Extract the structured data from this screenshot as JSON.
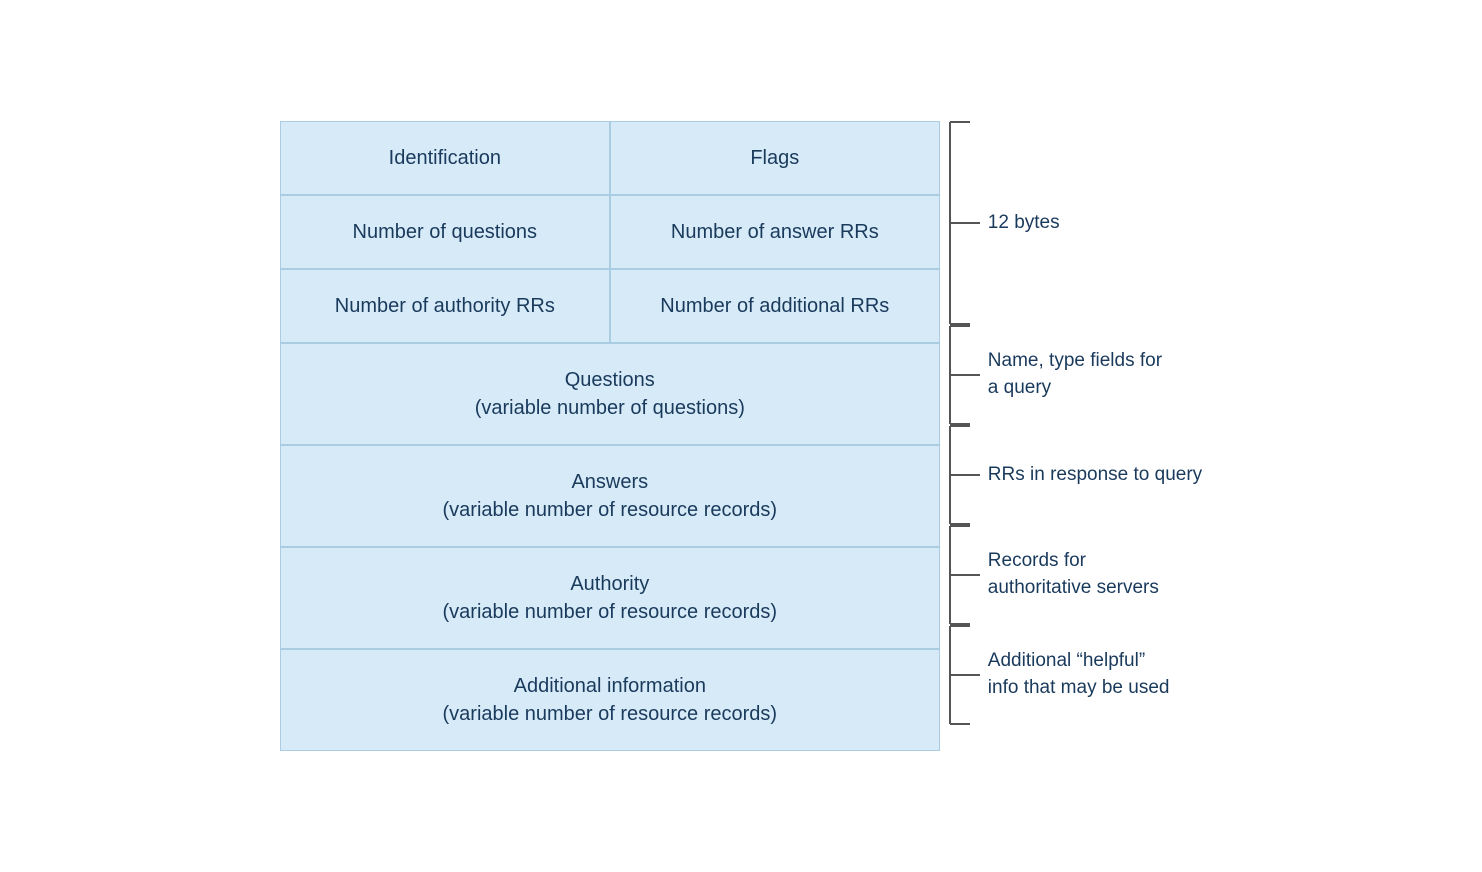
{
  "rows": [
    {
      "id": "row-identification",
      "cells": [
        {
          "id": "cell-identification",
          "text": "Identification",
          "span": "half"
        },
        {
          "id": "cell-flags",
          "text": "Flags",
          "span": "half"
        }
      ]
    },
    {
      "id": "row-questions-count",
      "cells": [
        {
          "id": "cell-num-questions",
          "text": "Number of questions",
          "span": "half"
        },
        {
          "id": "cell-num-answer-rrs",
          "text": "Number of answer RRs",
          "span": "half"
        }
      ]
    },
    {
      "id": "row-authority-count",
      "cells": [
        {
          "id": "cell-num-authority-rrs",
          "text": "Number of authority RRs",
          "span": "half"
        },
        {
          "id": "cell-num-additional-rrs",
          "text": "Number of additional RRs",
          "span": "half"
        }
      ]
    },
    {
      "id": "row-questions",
      "cells": [
        {
          "id": "cell-questions",
          "text": "Questions\n(variable number of questions)",
          "span": "full"
        }
      ]
    },
    {
      "id": "row-answers",
      "cells": [
        {
          "id": "cell-answers",
          "text": "Answers\n(variable number of resource records)",
          "span": "full"
        }
      ]
    },
    {
      "id": "row-authority",
      "cells": [
        {
          "id": "cell-authority",
          "text": "Authority\n(variable number of resource records)",
          "span": "full"
        }
      ]
    },
    {
      "id": "row-additional",
      "cells": [
        {
          "id": "cell-additional",
          "text": "Additional information\n(variable number of resource records)",
          "span": "full"
        }
      ]
    }
  ],
  "annotations": [
    {
      "id": "annotation-header",
      "label": "12 bytes",
      "rows_span": 3,
      "multiline": false
    },
    {
      "id": "annotation-questions",
      "label": "Name, type fields for\na query",
      "rows_span": 1,
      "multiline": true
    },
    {
      "id": "annotation-answers",
      "label": "RRs in response to query",
      "rows_span": 1,
      "multiline": false
    },
    {
      "id": "annotation-authority",
      "label": "Records for\nauthoritative servers",
      "rows_span": 1,
      "multiline": true
    },
    {
      "id": "annotation-additional",
      "label": "Additional “helpful”\ninfo that may be used",
      "rows_span": 1,
      "multiline": true
    }
  ]
}
